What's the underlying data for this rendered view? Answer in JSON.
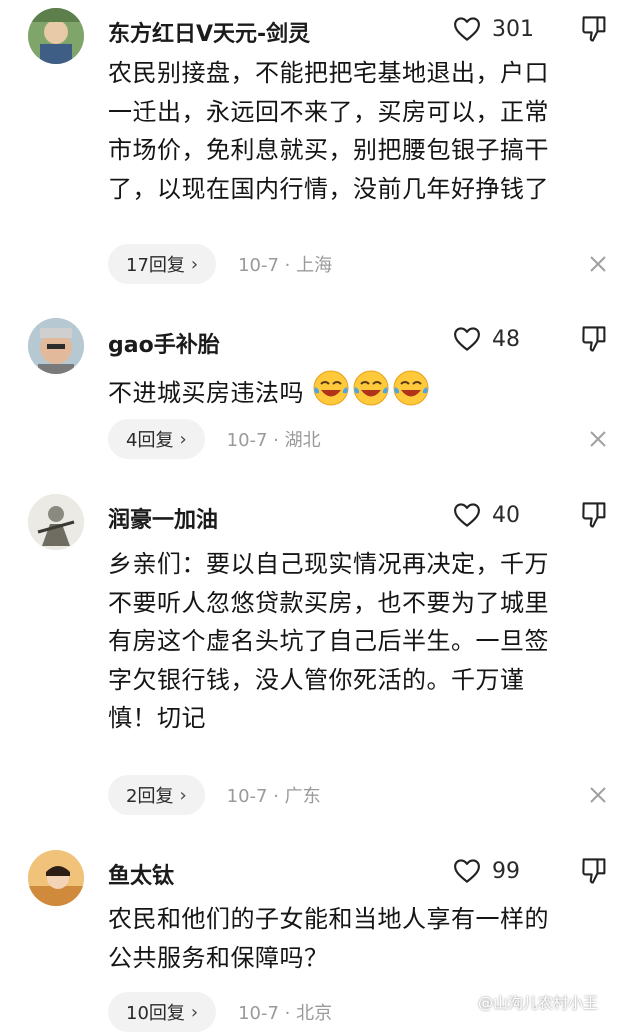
{
  "comments": [
    {
      "username": "东方红日V天元-剑灵",
      "likes": "301",
      "lines": [
        "农民别接盘，不能把把宅基地退出，户口",
        "一迁出，永远回不来了，买房可以，正常",
        "市场价，免利息就买，别把腰包银子搞干",
        "了，以现在国内行情，没前几年好挣钱了"
      ],
      "replies": "17回复",
      "meta": "10-7 · 上海"
    },
    {
      "username": "gao手补胎",
      "likes": "48",
      "lines": [
        "不进城买房违法吗"
      ],
      "emoji": [
        "crying-laughing-emoji",
        "crying-laughing-emoji",
        "crying-laughing-emoji"
      ],
      "replies": "4回复",
      "meta": "10-7 · 湖北"
    },
    {
      "username": "润豪一加油",
      "likes": "40",
      "lines": [
        "乡亲们：要以自己现实情况再决定，千万",
        "不要听人忽悠贷款买房，也不要为了城里",
        "有房这个虚名头坑了自己后半生。一旦签",
        "字欠银行钱，没人管你死活的。千万谨",
        "慎！切记"
      ],
      "replies": "2回复",
      "meta": "10-7 · 广东"
    },
    {
      "username": "鱼太钛",
      "likes": "99",
      "lines": [
        "农民和他们的子女能和当地人享有一样的",
        "公共服务和保障吗？"
      ],
      "replies": "10回复",
      "meta": "10-7 · 北京"
    }
  ],
  "watermark": "@山沟儿农村小王",
  "icons": {
    "like": "heart-outline-icon",
    "dislike": "thumbs-down-icon",
    "close": "close-icon",
    "reply_chevron": "chevron-right-icon"
  },
  "colors": {
    "meta_gray": "#9a9a9a",
    "pill_bg": "#f2f2f2",
    "text": "#151515"
  }
}
